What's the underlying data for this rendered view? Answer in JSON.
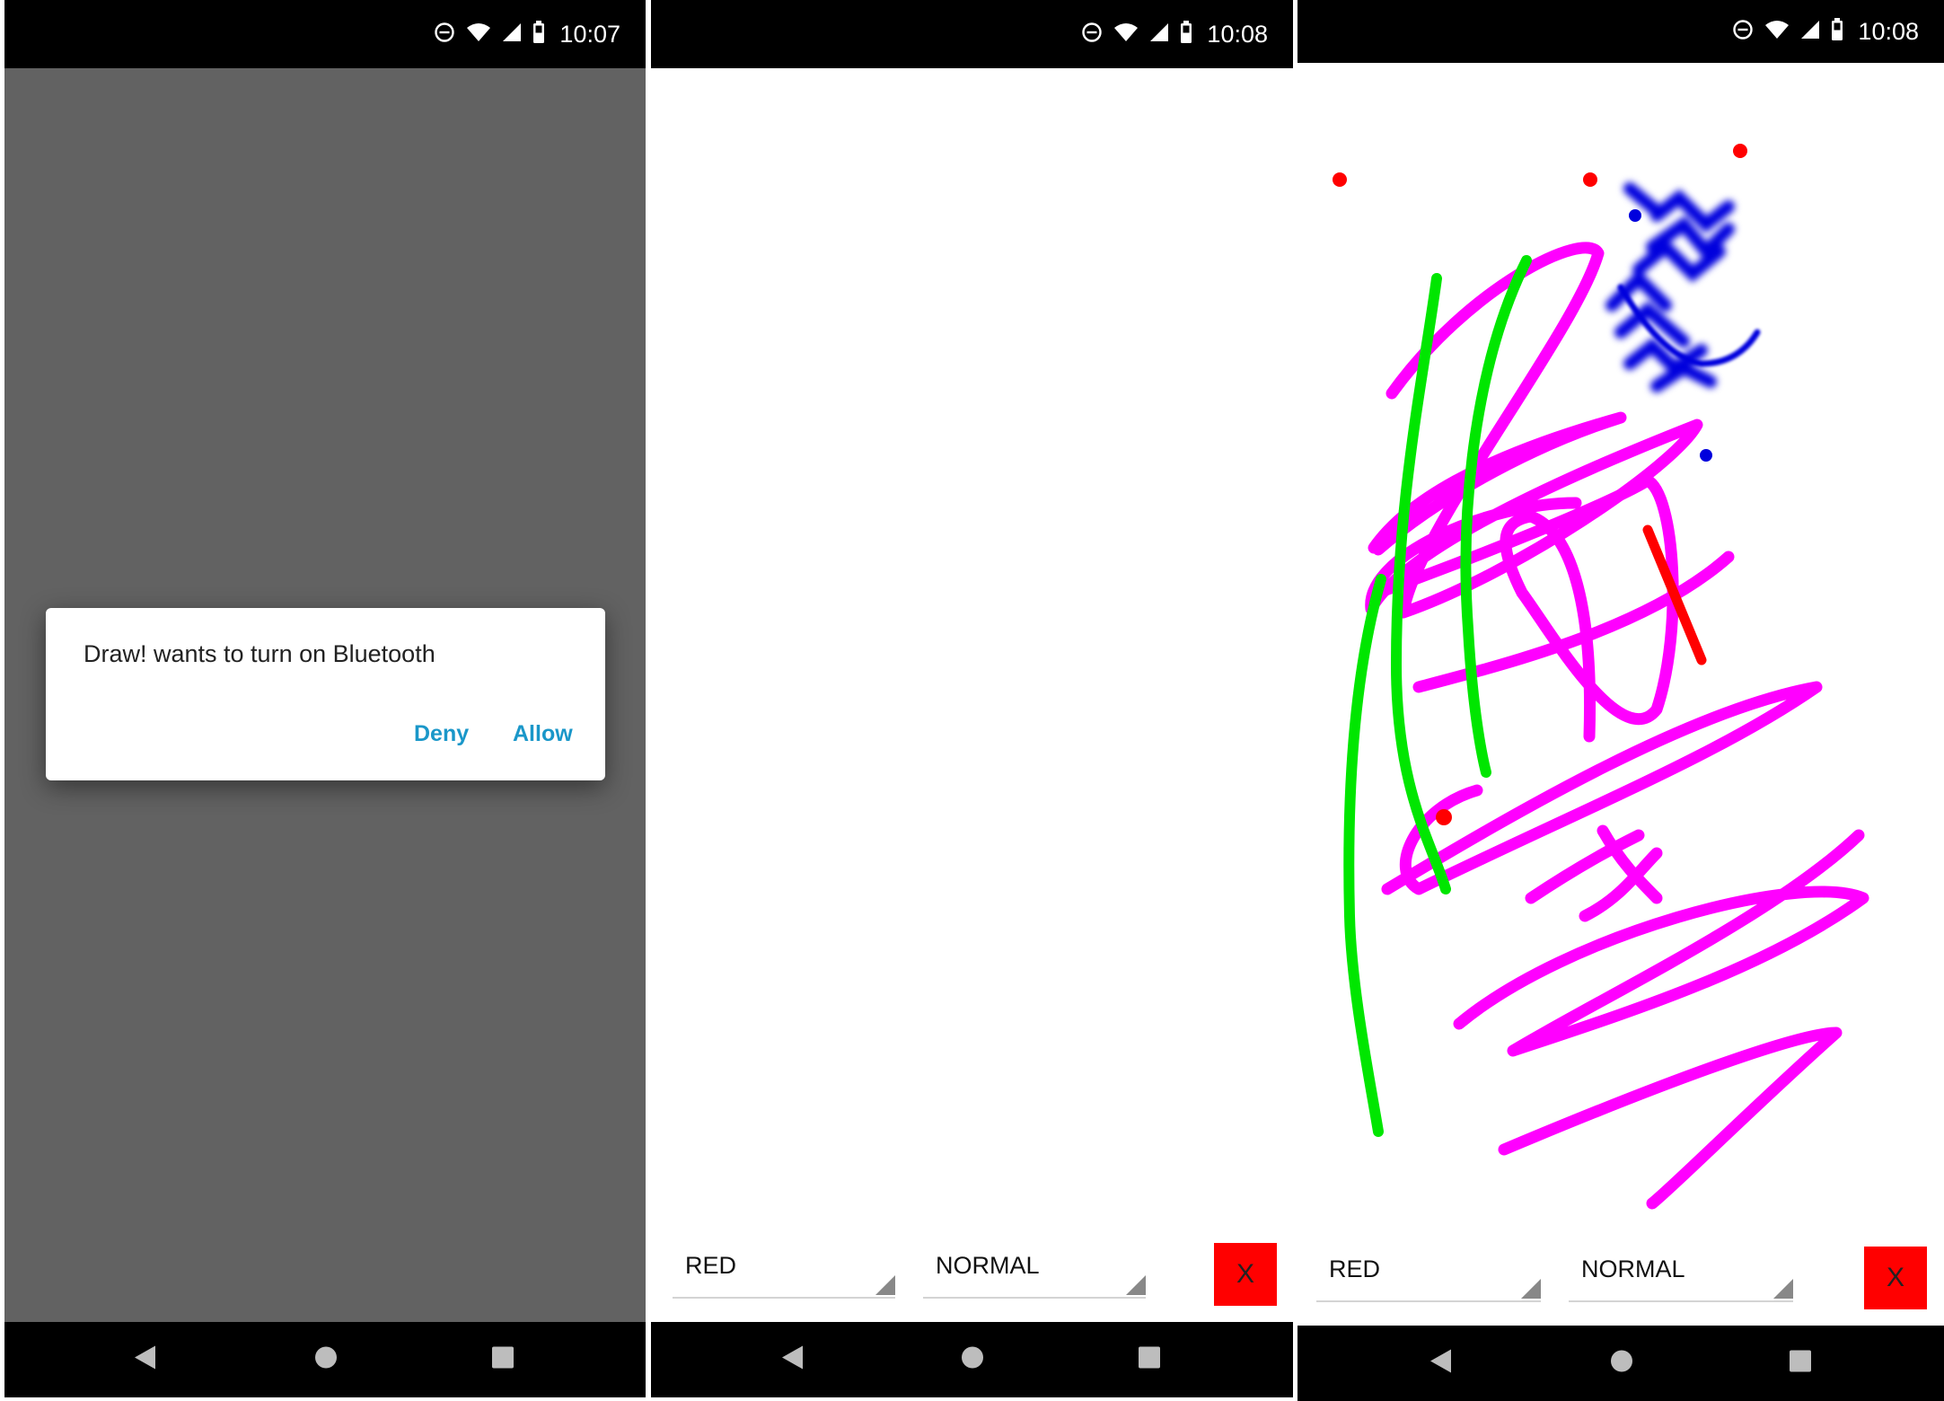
{
  "screens": [
    {
      "status_time": "10:07",
      "dialog": {
        "message": "Draw! wants to turn on Bluetooth",
        "deny_label": "Deny",
        "allow_label": "Allow"
      }
    },
    {
      "status_time": "10:08",
      "color_spinner": {
        "selected": "RED"
      },
      "style_spinner": {
        "selected": "NORMAL"
      },
      "clear_button": {
        "label": "X"
      }
    },
    {
      "status_time": "10:08",
      "color_spinner": {
        "selected": "RED"
      },
      "style_spinner": {
        "selected": "NORMAL"
      },
      "clear_button": {
        "label": "X"
      }
    }
  ],
  "icons": {
    "status": [
      "do-not-disturb-icon",
      "wifi-icon",
      "cell-signal-icon",
      "battery-icon"
    ],
    "nav": [
      "back-icon",
      "home-icon",
      "recents-icon"
    ]
  },
  "colors": {
    "accent": "#1a97c9",
    "scrim": "#626262",
    "clear_button": "#ff0000",
    "stroke_magenta": "#ff00ff",
    "stroke_green": "#00e600",
    "stroke_blue": "#0000dd",
    "stroke_red": "#ff0000"
  }
}
